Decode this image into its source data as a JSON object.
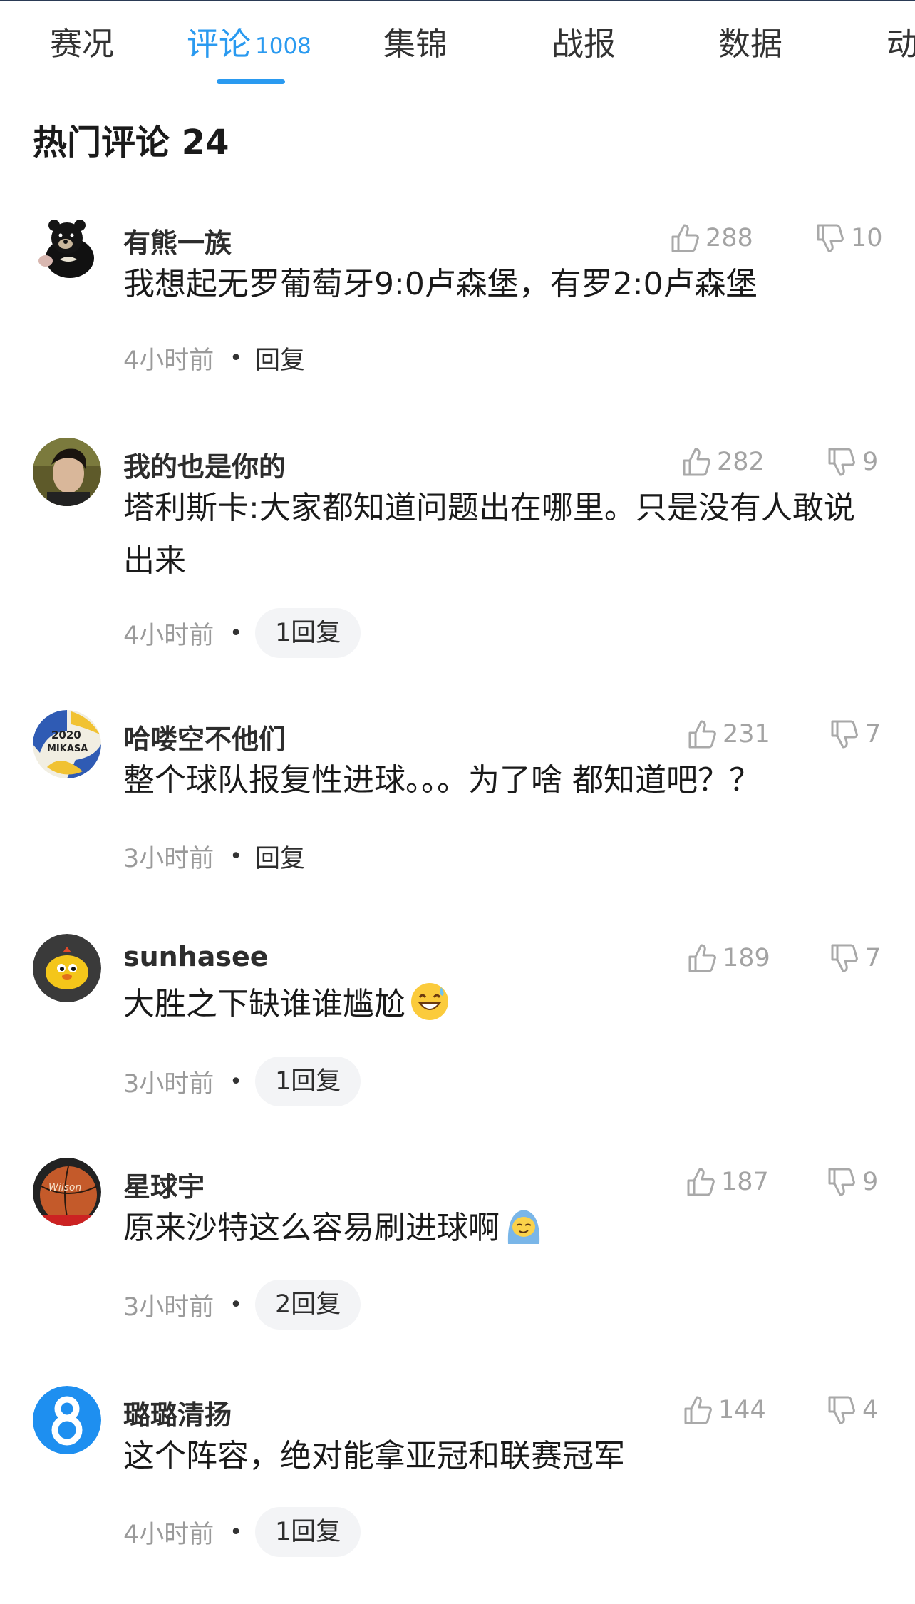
{
  "tabs": [
    {
      "label": "赛况"
    },
    {
      "label": "评论",
      "count": "1008"
    },
    {
      "label": "集锦"
    },
    {
      "label": "战报"
    },
    {
      "label": "数据"
    },
    {
      "label": "动"
    }
  ],
  "section": {
    "title": "热门评论 24"
  },
  "comments": [
    {
      "user": "有熊一族",
      "likes": "288",
      "dislikes": "10",
      "text": "我想起无罗葡萄牙9:0卢森堡，有罗2:0卢森堡",
      "time": "4小时前",
      "reply": "回复"
    },
    {
      "user": "我的也是你的",
      "likes": "282",
      "dislikes": "9",
      "text": "塔利斯卡:大家都知道问题出在哪里。只是没有人敢说出来",
      "time": "4小时前",
      "reply": "1回复"
    },
    {
      "user": "哈喽空不他们",
      "likes": "231",
      "dislikes": "7",
      "text": "整个球队报复性进球。。。为了啥 都知道吧？？",
      "time": "3小时前",
      "reply": "回复"
    },
    {
      "user": "sunhasee",
      "likes": "189",
      "dislikes": "7",
      "text": "大胜之下缺谁谁尴尬",
      "time": "3小时前",
      "reply": "1回复"
    },
    {
      "user": "星球宇",
      "likes": "187",
      "dislikes": "9",
      "text": "原来沙特这么容易刷进球啊",
      "time": "3小时前",
      "reply": "2回复"
    },
    {
      "user": "璐璐清扬",
      "likes": "144",
      "dislikes": "4",
      "text": "这个阵容，绝对能拿亚冠和联赛冠军",
      "time": "4小时前",
      "reply": "1回复"
    }
  ],
  "colors": {
    "accent": "#2a9af0",
    "muted": "#a3a3a3",
    "pill": "#f3f4f6"
  },
  "icons": {
    "like": "thumbs-up-icon",
    "dislike": "thumbs-down-icon",
    "emoji_sweat": "grinning-sweat-emoji",
    "emoji_smirk": "smirking-hooded-emoji"
  }
}
